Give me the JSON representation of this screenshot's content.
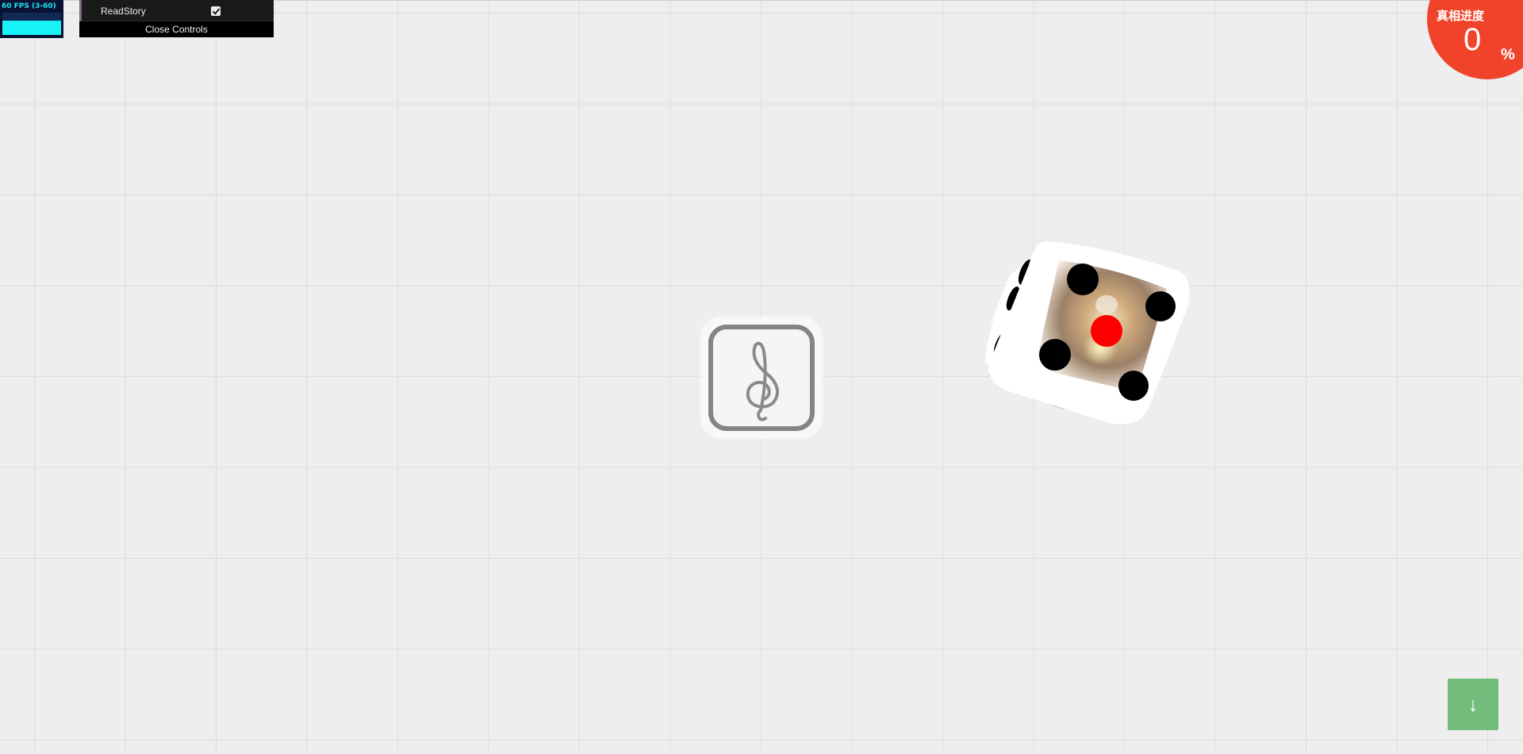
{
  "fps_panel": {
    "text": "60 FPS (3-60)",
    "graph_level": 0.65,
    "colors": {
      "background": "#0b1133",
      "text": "#19e6f2",
      "fill": "#19f3f8"
    }
  },
  "controls": {
    "items": [
      {
        "label": "ReadStory",
        "type": "checkbox",
        "checked": true
      }
    ],
    "close_label": "Close Controls"
  },
  "progress": {
    "label": "真相进度",
    "value": "0",
    "unit": "%",
    "color": "#f1432a"
  },
  "music_toggle": {
    "icon": "treble-clef-icon"
  },
  "dice": {
    "front_face_value": 5,
    "center_pip_color": "#ff0000",
    "pip_color": "#000000"
  },
  "scroll_button": {
    "icon": "arrow-down-icon",
    "label": "↓",
    "color": "#72bd7c"
  }
}
